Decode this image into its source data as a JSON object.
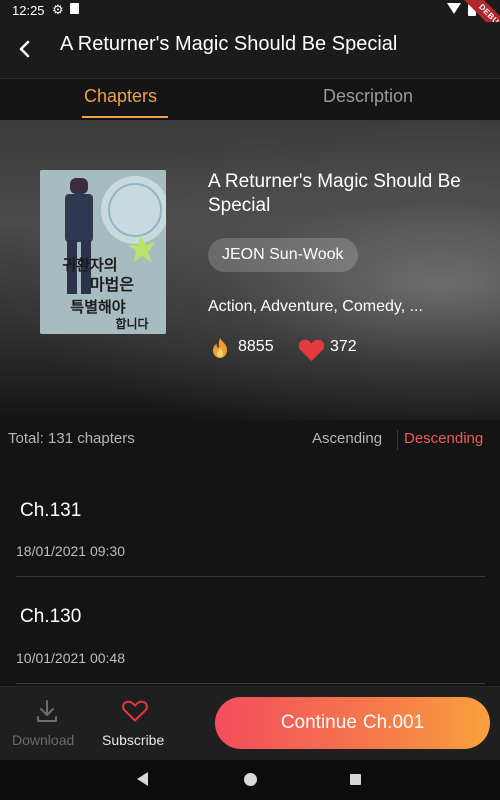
{
  "status_bar": {
    "time": "12:25",
    "debug_label": "DEBUG"
  },
  "app_bar": {
    "title": "A Returner's Magic Should Be Special"
  },
  "tabs": [
    {
      "label": "Chapters",
      "active": true
    },
    {
      "label": "Description",
      "active": false
    }
  ],
  "book": {
    "title": "A Returner's Magic Should Be Special",
    "author": "JEON Sun-Wook",
    "genres": "Action, Adventure, Comedy, ...",
    "views": "8855",
    "likes": "372",
    "cover_text": "귀환자의 마법은 특별해야 합니다"
  },
  "list_header": {
    "total": "Total: 131 chapters",
    "sort_ascending": "Ascending",
    "sort_descending": "Descending",
    "active_sort": "Descending"
  },
  "chapters": [
    {
      "title": "Ch.131",
      "date": "18/01/2021 09:30"
    },
    {
      "title": "Ch.130",
      "date": "10/01/2021 00:48"
    }
  ],
  "bottom_bar": {
    "download_label": "Download",
    "subscribe_label": "Subscribe",
    "continue_prefix": "Continue",
    "continue_chapter": "Ch.001"
  },
  "colors": {
    "accent": "#f0a04b",
    "active_sort": "#ef5a56",
    "heart": "#e8383f",
    "button_gradient_start": "#f34d5e",
    "button_gradient_end": "#f9a13e"
  },
  "icons": {
    "back": "back-arrow-icon",
    "views": "fire-icon",
    "likes": "heart-icon",
    "download": "download-icon",
    "subscribe": "heart-outline-icon"
  }
}
